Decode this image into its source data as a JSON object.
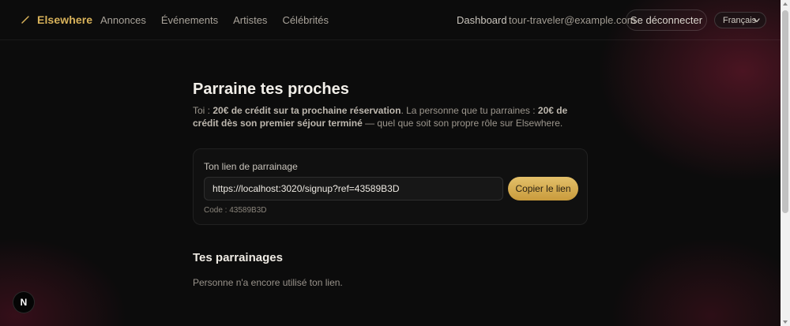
{
  "header": {
    "brand": "Elsewhere",
    "nav": [
      "Annonces",
      "Événements",
      "Artistes",
      "Célébrités"
    ],
    "dashboard": "Dashboard",
    "email": "tour-traveler@example.com",
    "logout": "Se déconnecter",
    "language": "Français"
  },
  "main": {
    "title": "Parraine tes proches",
    "desc_1": "Toi : ",
    "desc_2": "20€ de crédit sur ta prochaine réservation",
    "desc_3": ". La personne que tu parraines : ",
    "desc_4": "20€ de crédit dès son premier séjour terminé",
    "desc_5": " — quel que soit son propre rôle sur Elsewhere."
  },
  "card": {
    "label": "Ton lien de parrainage",
    "link": "https://localhost:3020/signup?ref=43589B3D",
    "copy": "Copier le lien",
    "code": "Code : 43589B3D"
  },
  "referrals": {
    "title": "Tes parrainages",
    "empty": "Personne n'a encore utilisé ton lien."
  },
  "dev_badge": "N",
  "colors": {
    "accent": "#d8b25a",
    "background": "#0c0c0c"
  },
  "icons": {
    "brand": "brand-slash-icon",
    "chevron": "chevron-down-icon"
  }
}
